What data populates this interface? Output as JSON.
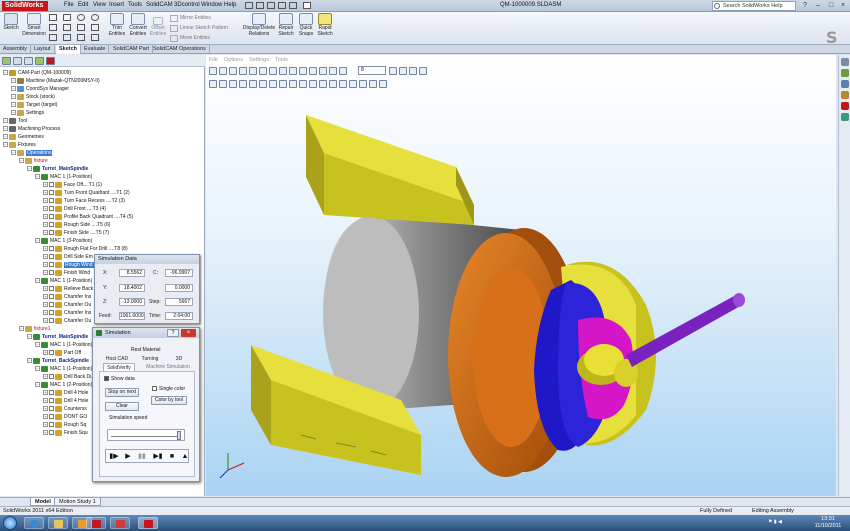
{
  "app": {
    "logo_text": "SolidWorks",
    "document_title": "QM-1000009.SLDASM",
    "search_placeholder": "Search SolidWorks Help",
    "menu": [
      "File",
      "Edit",
      "View",
      "Insert",
      "Tools",
      "SolidCAM",
      "3Dcontrol",
      "Window",
      "Help"
    ]
  },
  "command_manager": {
    "big_tools": [
      {
        "label": "Sketch",
        "icon": "sketch-icon"
      },
      {
        "label": "Smart\nDimension",
        "icon": "smart-dimension-icon"
      },
      {
        "label": "Trim\nEntities",
        "icon": "trim-entities-icon"
      },
      {
        "label": "Convert\nEntities",
        "icon": "convert-entities-icon"
      },
      {
        "label": "Offset\nEntities",
        "icon": "offset-entities-icon"
      },
      {
        "label": "Display/Delete\nRelations",
        "icon": "relations-icon"
      },
      {
        "label": "Repair\nSketch",
        "icon": "repair-sketch-icon"
      },
      {
        "label": "Quick\nSnaps",
        "icon": "quick-snaps-icon"
      },
      {
        "label": "Rapid\nSketch",
        "icon": "rapid-sketch-icon"
      }
    ],
    "small_tools": [
      "Mirror Entities",
      "Linear Sketch Pattern",
      "Move Entities"
    ],
    "tabs": [
      "Assembly",
      "Layout",
      "Sketch",
      "Evaluate",
      "SolidCAM Part",
      "SolidCAM Operations"
    ],
    "active_tab": "Sketch"
  },
  "viewport": {
    "menu": [
      "File",
      "Options",
      "Settings",
      "Tools"
    ],
    "zoom_value": "8"
  },
  "tree": [
    {
      "indent": 0,
      "label": "CAM-Part (QM-100009)",
      "icon_color": "#c49a2c"
    },
    {
      "indent": 1,
      "label": "Machine (Mazak-QTN200MSY-II)",
      "icon_color": "#9a7b3a"
    },
    {
      "indent": 1,
      "label": "CoordSys Manager",
      "icon_color": "#5a8fd0"
    },
    {
      "indent": 1,
      "label": "Stock (stock)",
      "icon_color": "#c8a84a"
    },
    {
      "indent": 1,
      "label": "Target (target)",
      "icon_color": "#c8a84a"
    },
    {
      "indent": 1,
      "label": "Settings",
      "icon_color": "#c8a84a"
    },
    {
      "indent": 0,
      "label": "Tool",
      "icon_color": "#666666"
    },
    {
      "indent": 0,
      "label": "Machining Process",
      "icon_color": "#666666"
    },
    {
      "indent": 0,
      "label": "Geometries",
      "icon_color": "#c8a84a"
    },
    {
      "indent": 0,
      "label": "Fixtures",
      "icon_color": "#c8a84a"
    },
    {
      "indent": 1,
      "label": "Operations",
      "icon_color": "#c8a84a",
      "highlight": true
    },
    {
      "indent": 2,
      "label": "fixture",
      "icon_color": "#c8a84a",
      "red": true
    },
    {
      "indent": 3,
      "label": "Turret_MainSpindle",
      "icon_color": "#3a8a3a",
      "bold": true
    },
    {
      "indent": 4,
      "label": "MAC 1 (1-Position)",
      "icon_color": "#3a8a3a"
    },
    {
      "indent": 5,
      "label": "Face Off....T1 (1)",
      "icon_color": "#d6a11e",
      "check": true
    },
    {
      "indent": 5,
      "label": "Turn Front Quadrant ....T1 (2)",
      "icon_color": "#d6a11e",
      "check": true
    },
    {
      "indent": 5,
      "label": "Turn Face Recess ....T2 (3)",
      "icon_color": "#d6a11e",
      "check": true
    },
    {
      "indent": 5,
      "label": "Drill Front ....T3 (4)",
      "icon_color": "#d6a11e",
      "check": true
    },
    {
      "indent": 5,
      "label": "Profile Back Quadrant ....T4 (5)",
      "icon_color": "#d6a11e",
      "check": true
    },
    {
      "indent": 5,
      "label": "Rough Side ....T5 (6)",
      "icon_color": "#d6a11e",
      "check": true
    },
    {
      "indent": 5,
      "label": "Finish Side ....T5 (7)",
      "icon_color": "#d6a11e",
      "check": true
    },
    {
      "indent": 4,
      "label": "MAC 1 (3-Position)",
      "icon_color": "#3a8a3a"
    },
    {
      "indent": 5,
      "label": "Rough Flat For Drill ....T8 (8)",
      "icon_color": "#d6a11e",
      "check": true
    },
    {
      "indent": 5,
      "label": "Drill Side Em",
      "icon_color": "#d6a11e",
      "check": true
    },
    {
      "indent": 5,
      "label": "Rough Wind",
      "icon_color": "#d6a11e",
      "check": true,
      "highlight": true
    },
    {
      "indent": 5,
      "label": "Finish Wind",
      "icon_color": "#d6a11e",
      "check": true
    },
    {
      "indent": 4,
      "label": "MAC 1 (1-Position)",
      "icon_color": "#3a8a3a"
    },
    {
      "indent": 5,
      "label": "Relieve Back",
      "icon_color": "#d6a11e",
      "check": true
    },
    {
      "indent": 5,
      "label": "Chamfer Ins",
      "icon_color": "#d6a11e",
      "check": true
    },
    {
      "indent": 5,
      "label": "Chamfer Ou",
      "icon_color": "#d6a11e",
      "check": true
    },
    {
      "indent": 5,
      "label": "Chamfer Ins",
      "icon_color": "#d6a11e",
      "check": true
    },
    {
      "indent": 5,
      "label": "Chamfer Ou",
      "icon_color": "#d6a11e",
      "check": true
    },
    {
      "indent": 2,
      "label": "fixture1",
      "icon_color": "#c8a84a",
      "red": true
    },
    {
      "indent": 3,
      "label": "Turret_MainSpindle",
      "icon_color": "#3a8a3a",
      "bold": true
    },
    {
      "indent": 4,
      "label": "MAC 1 (1-Position)",
      "icon_color": "#3a8a3a"
    },
    {
      "indent": 5,
      "label": "Part Off",
      "icon_color": "#d6a11e",
      "check": true
    },
    {
      "indent": 3,
      "label": "Turret_BackSpindle",
      "icon_color": "#3a8a3a",
      "bold": true
    },
    {
      "indent": 4,
      "label": "MAC 1 (1-Position)",
      "icon_color": "#3a8a3a"
    },
    {
      "indent": 5,
      "label": "Drill Back Du",
      "icon_color": "#d6a11e",
      "check": true
    },
    {
      "indent": 4,
      "label": "MAC 1 (2-Position)",
      "icon_color": "#3a8a3a"
    },
    {
      "indent": 5,
      "label": "Drill 4 Hole",
      "icon_color": "#d6a11e",
      "check": true
    },
    {
      "indent": 5,
      "label": "Drill 4 Hole",
      "icon_color": "#d6a11e",
      "check": true
    },
    {
      "indent": 5,
      "label": "Counterss",
      "icon_color": "#d6a11e",
      "check": true
    },
    {
      "indent": 5,
      "label": "DONT GO",
      "icon_color": "#d6a11e",
      "check": true
    },
    {
      "indent": 5,
      "label": "Rough Sq",
      "icon_color": "#d6a11e",
      "check": true
    },
    {
      "indent": 5,
      "label": "Finish Squ",
      "icon_color": "#d6a11e",
      "check": true
    }
  ],
  "sim_data": {
    "title": "Simulation Data",
    "x_label": "X:",
    "x_value": "8.5562",
    "c_label": "C:",
    "c_value": "-96.9907",
    "y_label": "Y:",
    "y_value": "18.4002",
    "c2_value": "0.0000",
    "z_label": "Z:",
    "z_value": "-13.0000",
    "step_label": "Step:",
    "step_value": "5667",
    "feed_label": "Feed:",
    "feed_value": "1061.0000",
    "time_label": "Time:",
    "time_value": "2:04:00"
  },
  "simulation": {
    "title": "Simulation",
    "rest_material": "Rest Material",
    "tabs_row1": [
      "Host CAD",
      "Turning",
      "3D"
    ],
    "tabs_row2": [
      "SolidVerify",
      "Machine Simulation"
    ],
    "active_tab": "SolidVerify",
    "show_data_label": "Show data",
    "single_color_label": "Single color",
    "stop_on_next_label": "Stop on next",
    "color_by_tool_label": "Color by tool",
    "clear_label": "Clear",
    "speed_label": "Simulation speed",
    "speed_fraction": 0.95
  },
  "bottom_tabs": [
    "Model",
    "Motion Study 1"
  ],
  "status": {
    "edition": "SolidWorks 2011 x64 Edition",
    "state": "Fully Defined",
    "mode": "Editing Assembly"
  },
  "taskbar": {
    "time": "13:31",
    "date": "11/10/2011"
  },
  "colors": {
    "solidworks_red": "#c8151b",
    "stock_yellow": "#c8c21f",
    "part_orange": "#c8620f",
    "part_blue": "#1f18c8",
    "part_magenta": "#d416c8",
    "rod_purple": "#7a22c0"
  }
}
